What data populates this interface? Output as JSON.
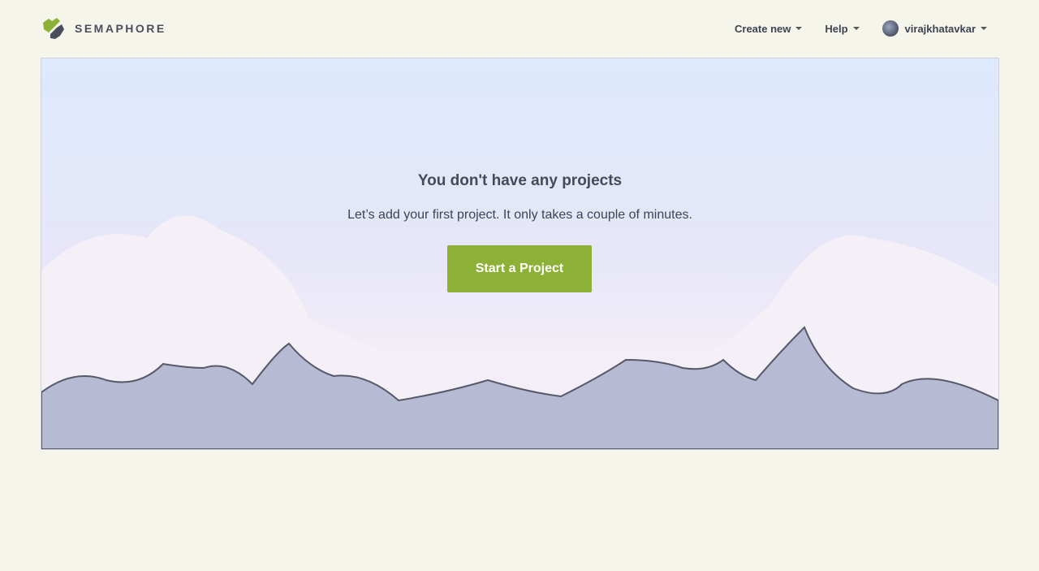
{
  "nav": {
    "brand": "SEMAPHORE",
    "create_new": "Create new",
    "help": "Help",
    "username": "virajkhatavkar"
  },
  "hero": {
    "title": "You don't have any projects",
    "subtitle": "Let’s add your first project. It only takes a couple of minutes.",
    "cta": "Start a Project"
  },
  "colors": {
    "accent": "#8db037"
  }
}
